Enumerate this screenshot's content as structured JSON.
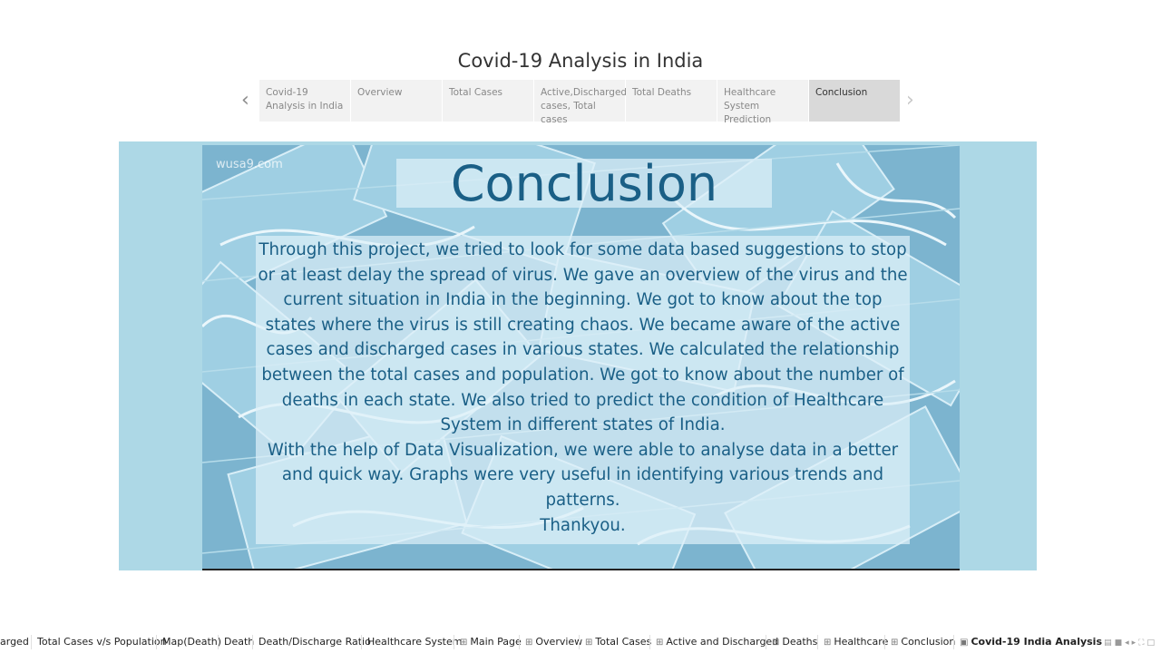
{
  "story": {
    "title": "Covid-19 Analysis in India",
    "points": [
      "Covid-19 Analysis in India",
      "Overview",
      "Total Cases",
      "Active,Discharged cases, Total cases",
      "Total Deaths",
      "Healthcare System Prediction",
      "Conclusion"
    ],
    "active_point": "Conclusion"
  },
  "dashboard": {
    "watermark": "wusa9.com",
    "heading": "Conclusion",
    "paragraph1": "Through this project, we tried to look for some data based suggestions to stop or at least delay the spread of virus. We gave an overview of the virus and the current situation in India in the beginning. We got to know about the top states where the virus is still creating chaos. We became aware of the active cases and discharged cases in various states. We calculated the relationship between the total cases and population. We got to know about the number of deaths in each state. We also tried to predict the condition of Healthcare System in different states of India.",
    "paragraph2": "With the help of Data Visualization, we were able to analyse data in a better and quick way. Graphs were very useful in identifying various trends and patterns.",
    "paragraph3": "Thankyou.",
    "colors": {
      "frame": "#add8e6",
      "text": "#1a5f86",
      "overlay": "#def0f8"
    }
  },
  "tabs": {
    "sheets": [
      "arged",
      "Total Cases v/s Population",
      "Map(Death)",
      "Death",
      "Death/Discharge Ratio",
      "Healthcare System"
    ],
    "dashboards": [
      "Main Page",
      "Overview",
      "Total Cases",
      "Active and Discharged",
      "Deaths",
      "Healthcare",
      "Conclusion"
    ],
    "story": "Covid-19 India Analysis",
    "dashboard_icon": "dashboard-grid-icon",
    "story_icon": "story-icon"
  }
}
